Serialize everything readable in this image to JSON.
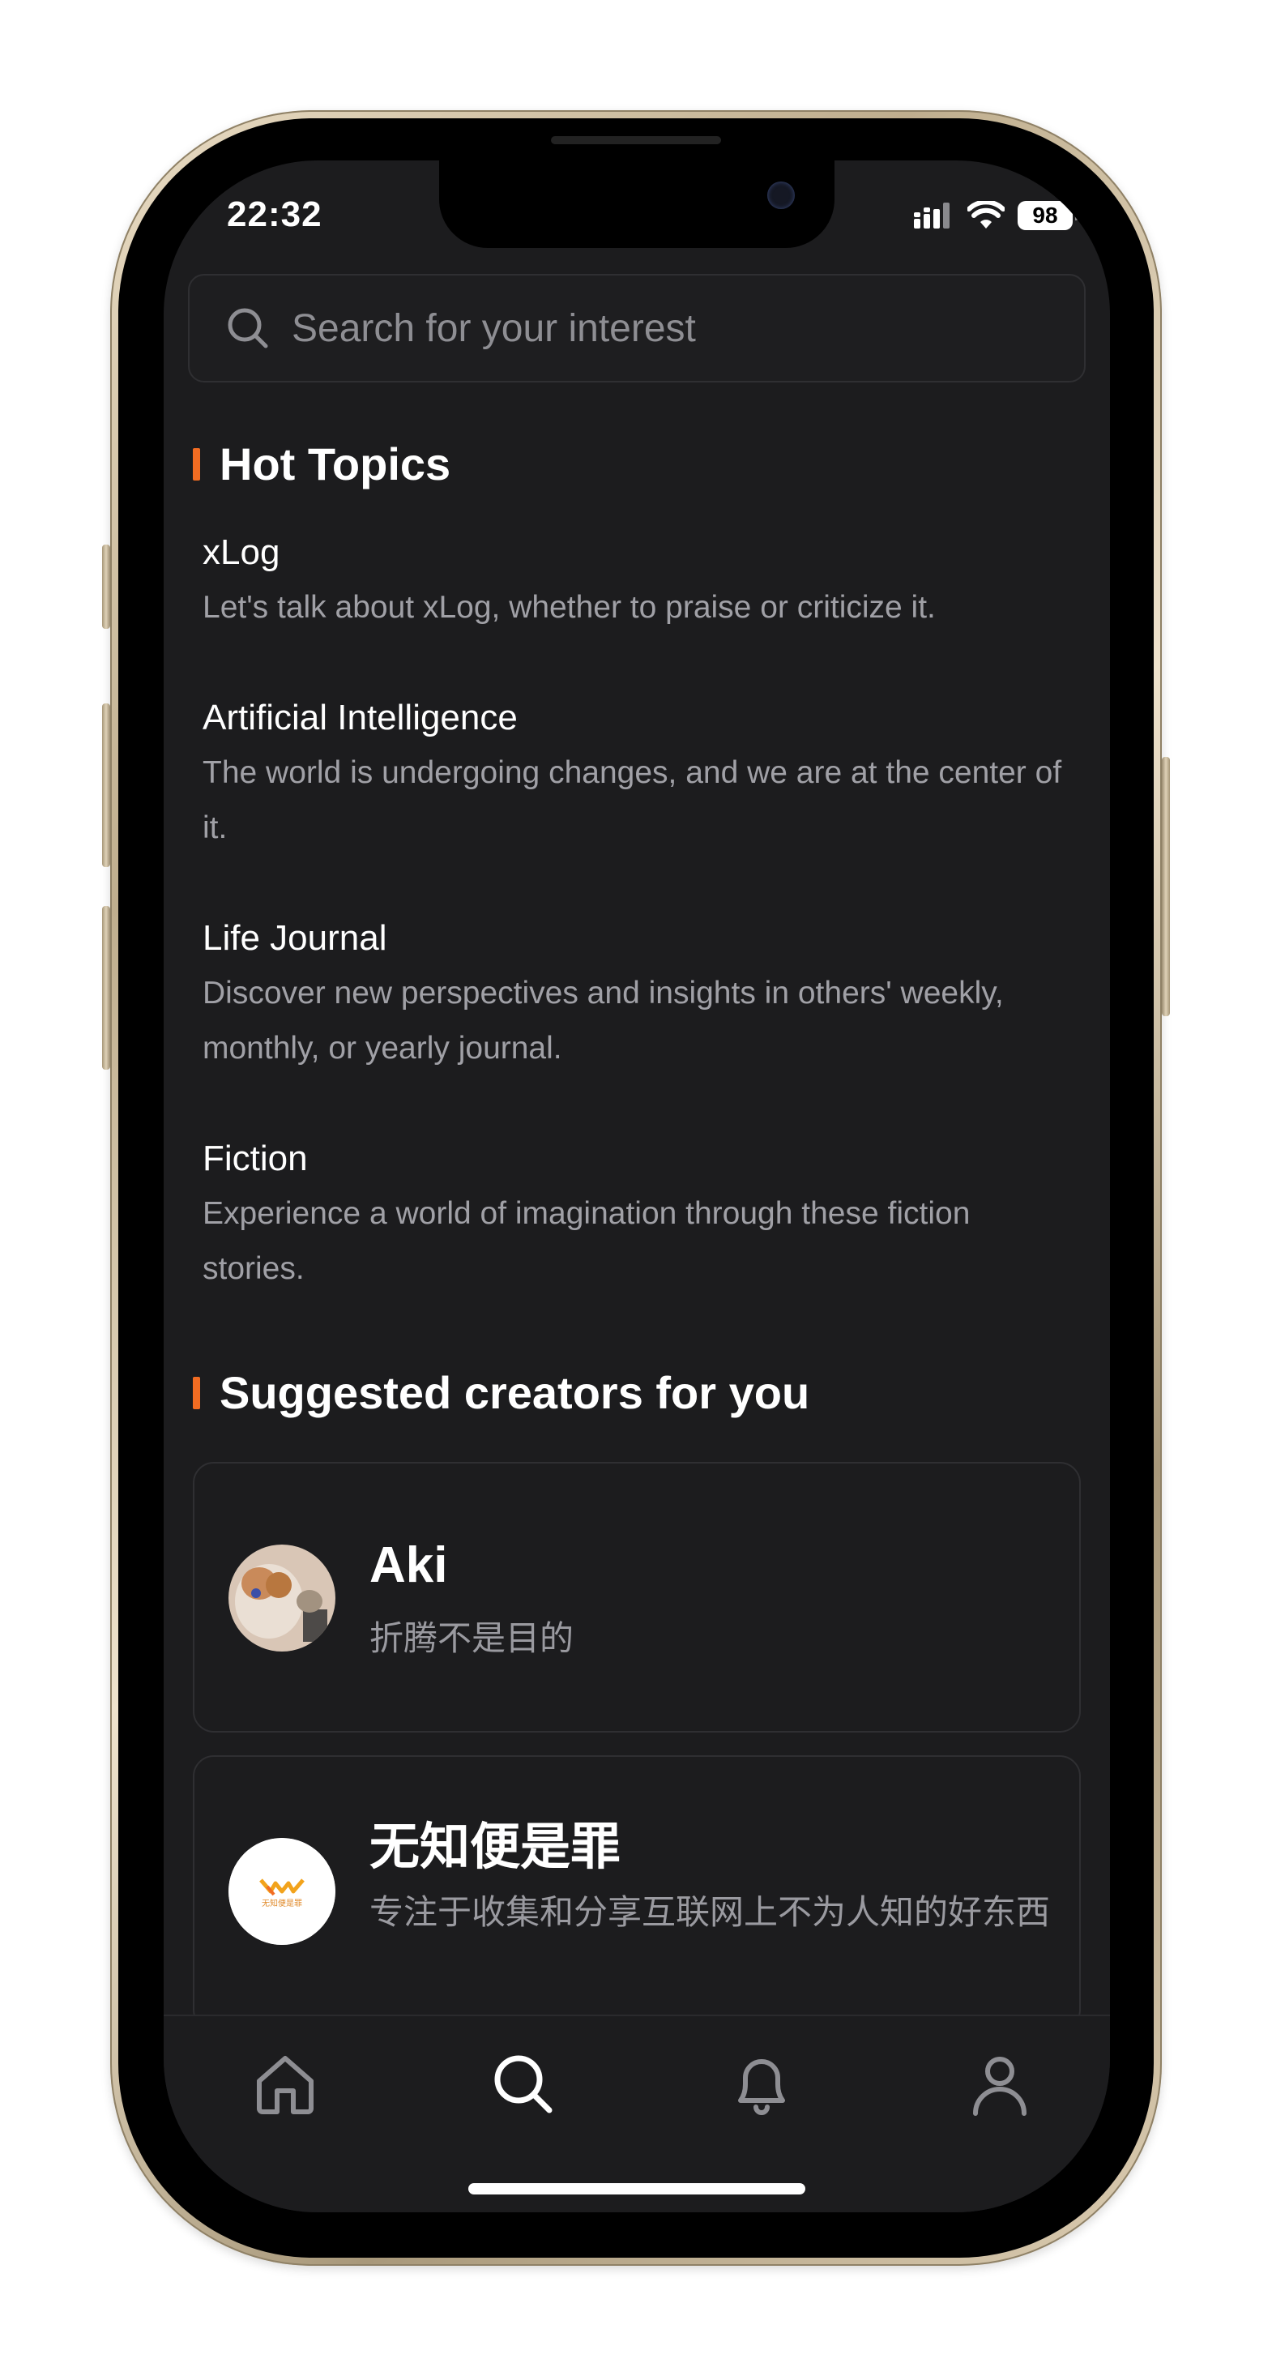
{
  "status_bar": {
    "time": "22:32",
    "battery": "98"
  },
  "search": {
    "placeholder": "Search for your interest"
  },
  "hot_topics": {
    "heading": "Hot Topics",
    "items": [
      {
        "title": "xLog",
        "description": "Let's talk about xLog, whether to praise or criticize it."
      },
      {
        "title": "Artificial Intelligence",
        "description": "The world is undergoing changes, and we are at the center of it."
      },
      {
        "title": "Life Journal",
        "description": "Discover new perspectives and insights in others' weekly, monthly, or yearly journal."
      },
      {
        "title": "Fiction",
        "description": "Experience a world of imagination through these fiction stories."
      }
    ]
  },
  "creators": {
    "heading": "Suggested creators for you",
    "items": [
      {
        "name": "Aki",
        "bio": "折腾不是目的"
      },
      {
        "name": "无知便是罪",
        "bio": "专注于收集和分享互联网上不为人知的好东西",
        "logo_text": "无知便是罪"
      }
    ]
  },
  "tab_bar": {
    "items": [
      "home-icon",
      "search-icon",
      "bell-icon",
      "user-icon"
    ],
    "active": "search-icon"
  },
  "colors": {
    "accent": "#f26c22",
    "background": "#1c1c1e",
    "text": "#ffffff",
    "muted": "#a0a0a6"
  }
}
